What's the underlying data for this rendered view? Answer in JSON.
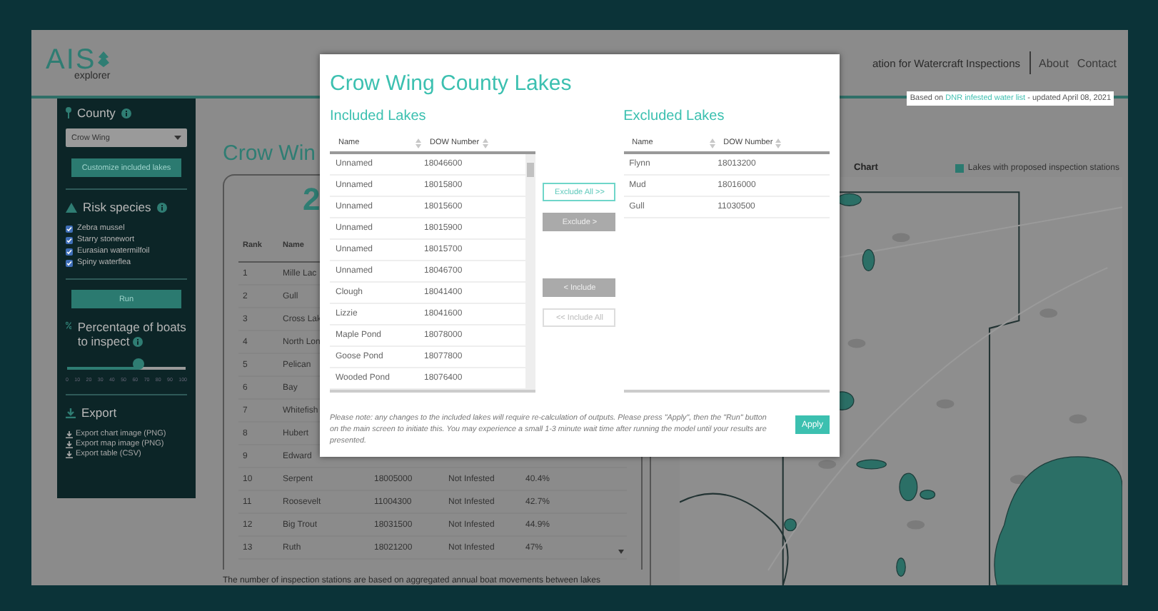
{
  "header": {
    "logo_text": "AIS",
    "logo_sub": "explorer",
    "title": "ation for Watercraft Inspections",
    "nav": [
      {
        "label": "About"
      },
      {
        "label": "Contact"
      }
    ],
    "source_note": {
      "prefix": "Based on",
      "link": "DNR infested water list",
      "suffix": "- updated April 08, 2021"
    }
  },
  "sidebar": {
    "county": {
      "label": "County",
      "value": "Crow Wing",
      "button": "Customize included lakes"
    },
    "risk": {
      "label": "Risk species",
      "species": [
        {
          "label": "Zebra mussel",
          "checked": true
        },
        {
          "label": "Starry stonewort",
          "checked": true
        },
        {
          "label": "Eurasian watermilfoil",
          "checked": true
        },
        {
          "label": "Spiny waterflea",
          "checked": true
        }
      ]
    },
    "run_button": "Run",
    "percentage": {
      "label": "Percentage of boats to inspect",
      "level": 0.6,
      "ticks": [
        "0",
        "10",
        "20",
        "30",
        "40",
        "50",
        "60",
        "70",
        "80",
        "90",
        "100"
      ]
    },
    "export": {
      "label": "Export",
      "links": [
        "Export chart image (PNG)",
        "Export map image (PNG)",
        "Export table (CSV)"
      ]
    }
  },
  "main": {
    "title": "Crow Win",
    "count": "2",
    "columns": [
      "Rank",
      "Name"
    ],
    "rows": [
      {
        "cells": [
          "1",
          "Mille Lac"
        ]
      },
      {
        "cells": [
          "2",
          "Gull"
        ]
      },
      {
        "cells": [
          "3",
          "Cross Lak"
        ]
      },
      {
        "cells": [
          "4",
          "North Lon"
        ]
      },
      {
        "cells": [
          "5",
          "Pelican"
        ]
      },
      {
        "cells": [
          "6",
          "Bay"
        ]
      },
      {
        "cells": [
          "7",
          "Whitefish"
        ]
      },
      {
        "cells": [
          "8",
          "Hubert"
        ]
      },
      {
        "cells": [
          "9",
          "Edward"
        ]
      },
      {
        "cells": [
          "10",
          "Serpent",
          "18005000",
          "Not Infested",
          "40.4%"
        ]
      },
      {
        "cells": [
          "11",
          "Roosevelt",
          "11004300",
          "Not Infested",
          "42.7%"
        ]
      },
      {
        "cells": [
          "12",
          "Big Trout",
          "18031500",
          "Not Infested",
          "44.9%"
        ]
      },
      {
        "cells": [
          "13",
          "Ruth",
          "18021200",
          "Not Infested",
          "47%"
        ]
      }
    ],
    "footnote": "The number of inspection stations are based on aggregated annual boat movements between lakes"
  },
  "map": {
    "title": "Chart",
    "legend": "Lakes with proposed inspection stations"
  },
  "modal": {
    "title": "Crow Wing County Lakes",
    "included": {
      "title": "Included Lakes",
      "columns": [
        "Name",
        "DOW Number"
      ],
      "rows": [
        {
          "name": "Unnamed",
          "dow": "18046600"
        },
        {
          "name": "Unnamed",
          "dow": "18015800"
        },
        {
          "name": "Unnamed",
          "dow": "18015600"
        },
        {
          "name": "Unnamed",
          "dow": "18015900"
        },
        {
          "name": "Unnamed",
          "dow": "18015700"
        },
        {
          "name": "Unnamed",
          "dow": "18046700"
        },
        {
          "name": "Clough",
          "dow": "18041400"
        },
        {
          "name": "Lizzie",
          "dow": "18041600"
        },
        {
          "name": "Maple Pond",
          "dow": "18078000"
        },
        {
          "name": "Goose Pond",
          "dow": "18077800"
        },
        {
          "name": "Wooded Pond",
          "dow": "18076400"
        }
      ]
    },
    "buttons": [
      {
        "label": "Exclude All >>",
        "kind": "outline",
        "disabled": false
      },
      {
        "label": "Exclude >",
        "kind": "filled",
        "disabled": false
      },
      {
        "label": "< Include",
        "kind": "filled",
        "disabled": false
      },
      {
        "label": "<< Include All",
        "kind": "outline",
        "disabled": true
      }
    ],
    "excluded": {
      "title": "Excluded Lakes",
      "columns": [
        "Name",
        "DOW Number"
      ],
      "rows": [
        {
          "name": "Flynn",
          "dow": "18013200"
        },
        {
          "name": "Mud",
          "dow": "18016000"
        },
        {
          "name": "Gull",
          "dow": "11030500"
        }
      ]
    },
    "note": "Please note: any changes to the included lakes will require re-calculation of outputs. Please press \"Apply\", then the \"Run\" button on the main screen to initiate this. You may experience a small 1-3 minute wait time after running the model until your results are presented.",
    "apply": "Apply"
  }
}
